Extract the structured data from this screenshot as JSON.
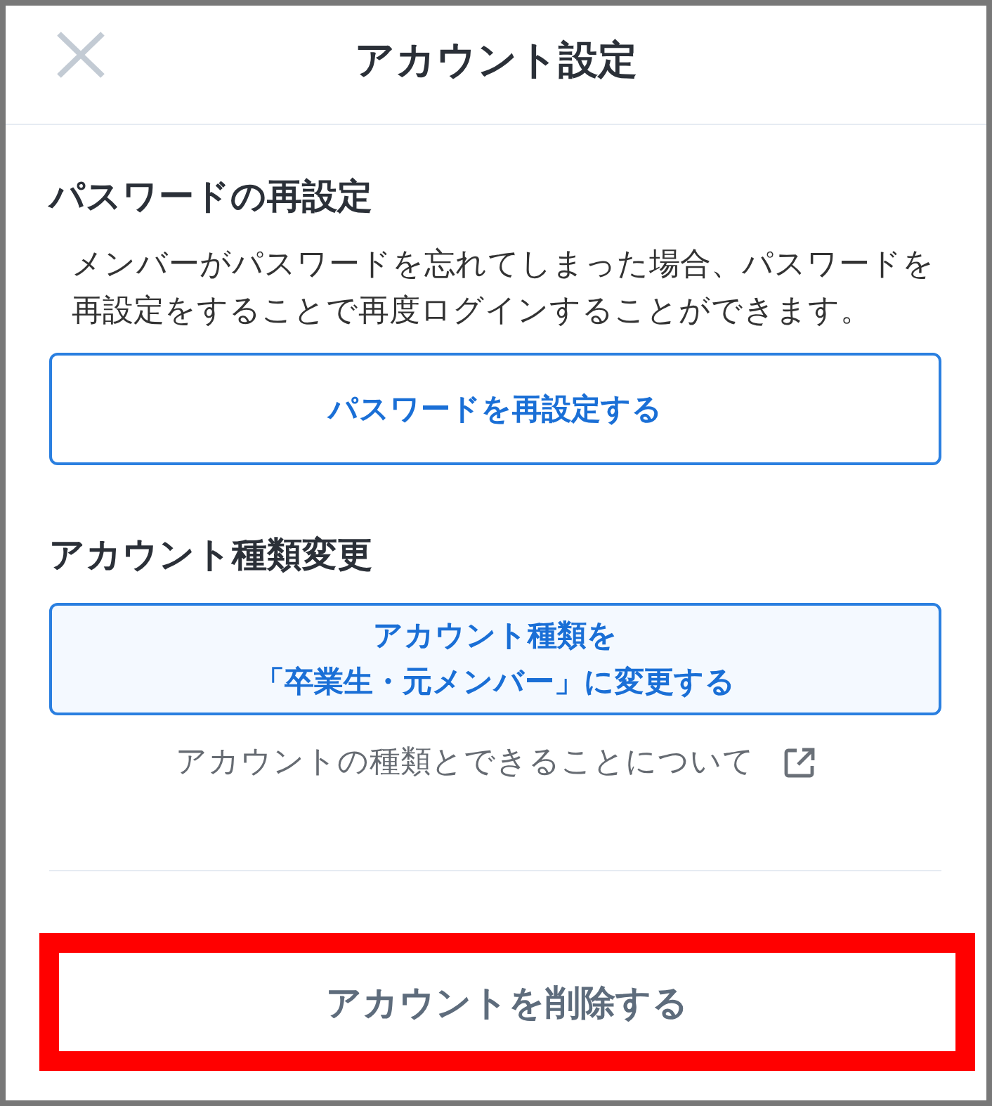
{
  "header": {
    "title": "アカウント設定"
  },
  "sections": [
    {
      "heading": "パスワードの再設定",
      "description": "メンバーがパスワードを忘れてしまった場合、パスワードを再設定をすることで再度ログインすることができます。",
      "button": {
        "kind": "outline",
        "lines": [
          "パスワードを再設定する"
        ]
      }
    },
    {
      "heading": "アカウント種類変更",
      "button": {
        "kind": "filled",
        "lines": [
          "アカウント種類を",
          "「卒業生・元メンバー」に変更する"
        ]
      },
      "link": {
        "label": "アカウントの種類とできることについて"
      }
    }
  ],
  "delete_button": {
    "label": "アカウントを削除する",
    "highlighted": true
  }
}
